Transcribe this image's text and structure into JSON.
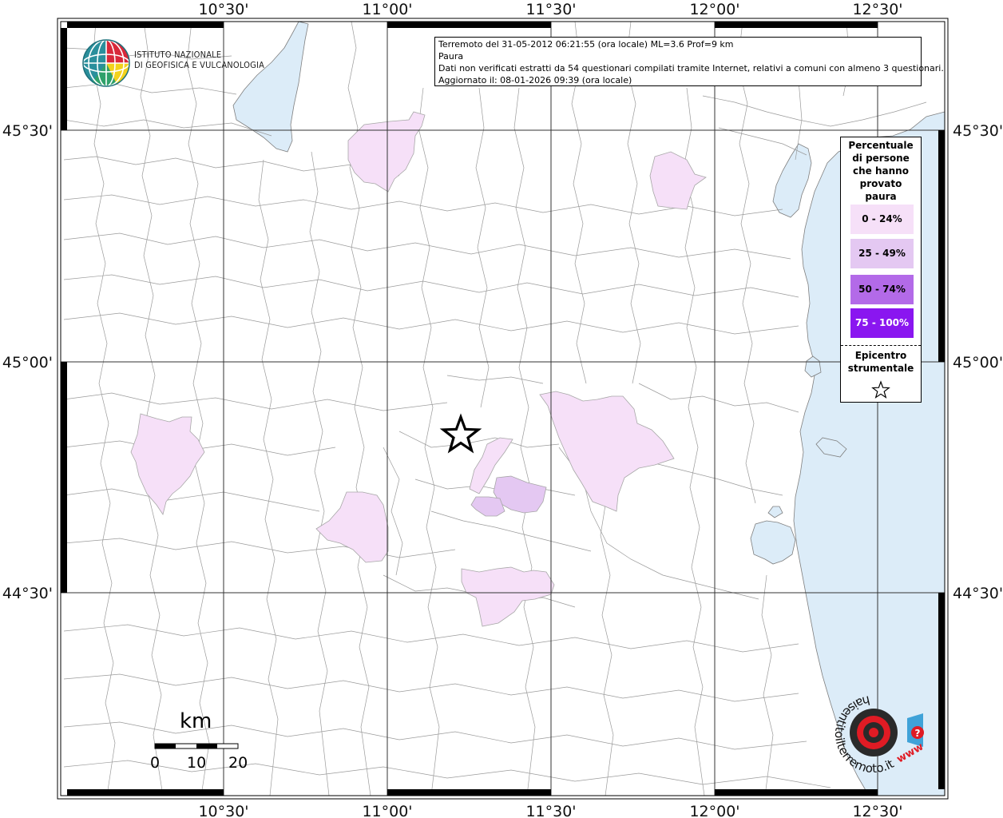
{
  "lon_labels": [
    "10°30'",
    "11°00'",
    "11°30'",
    "12°00'",
    "12°30'"
  ],
  "lat_labels": [
    "45°30'",
    "45°00'",
    "44°30'"
  ],
  "info": {
    "line1": "Terremoto del 31-05-2012 06:21:55 (ora locale) ML=3.6 Prof=9 km",
    "line2": "Paura",
    "line3": "Dati non verificati estratti da 54 questionari compilati tramite Internet, relativi a comuni con almeno 3 questionari.",
    "line4": "Aggiornato il: 08-01-2026 09:39 (ora locale)"
  },
  "institute": {
    "line1": "ISTITUTO NAZIONALE",
    "line2": "DI GEOFISICA E VULCANOLOGIA"
  },
  "legend": {
    "title_lines": [
      "Percentuale",
      "di persone",
      "che hanno",
      "provato",
      "paura"
    ],
    "classes": [
      {
        "label": "0 - 24%",
        "color": "#f6e0f8",
        "text_color": "#000000"
      },
      {
        "label": "25 - 49%",
        "color": "#e4c8f2",
        "text_color": "#000000"
      },
      {
        "label": "50 - 74%",
        "color": "#b36ae8",
        "text_color": "#000000"
      },
      {
        "label": "75 - 100%",
        "color": "#8a16f0",
        "text_color": "#ffffff"
      }
    ],
    "epicenter_lines": [
      "Epicentro",
      "strumentale"
    ],
    "epicenter_icon": "star-icon"
  },
  "scale": {
    "unit": "km",
    "labels": [
      "0",
      "10",
      "20"
    ]
  },
  "brand": {
    "text": "haisentitoilterremoto.it",
    "letters": "www",
    "icon": "megaphone-icon"
  },
  "colors": {
    "sea": "#dcecf8",
    "fill_low": "#f6e0f8",
    "fill_mid": "#e4c8f2",
    "borders": "#8f8f8f"
  }
}
